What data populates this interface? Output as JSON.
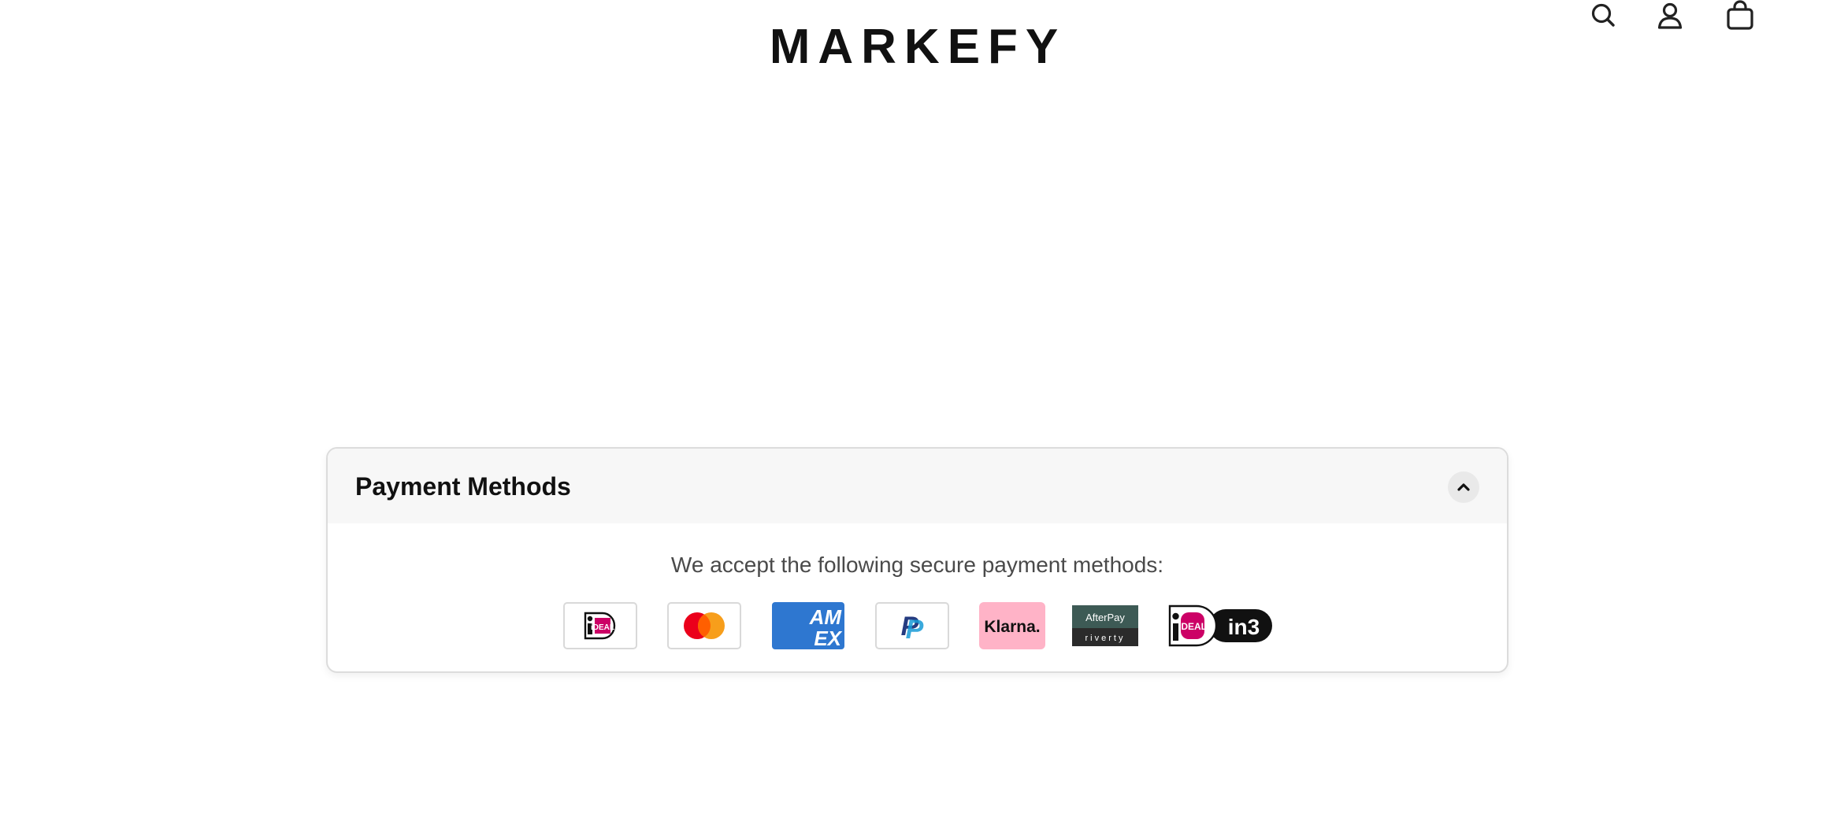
{
  "brand": {
    "logo_text": "MARKEFY"
  },
  "header": {
    "icons": [
      "search-icon",
      "account-icon",
      "cart-icon"
    ]
  },
  "accordion": {
    "title": "Payment Methods",
    "expanded": true,
    "toggle_icon": "chevron-up-icon",
    "description": "We accept the following secure payment methods:",
    "methods": [
      {
        "name": "iDEAL",
        "label": "iDEAL"
      },
      {
        "name": "Mastercard",
        "label": ""
      },
      {
        "name": "American Express",
        "label": "AM EX"
      },
      {
        "name": "PayPal",
        "label": "P"
      },
      {
        "name": "Klarna",
        "label": "Klarna."
      },
      {
        "name": "AfterPay Riverty",
        "label_top": "AfterPay",
        "label_bottom": "riverty"
      },
      {
        "name": "iDEAL in3",
        "label_left": "iDEAL",
        "label_right": "in3"
      }
    ]
  },
  "colors": {
    "ideal_pink": "#cc0066",
    "mastercard_red": "#eb001b",
    "mastercard_orange": "#f79e1b",
    "amex_blue": "#2e77d0",
    "paypal_dark": "#253b80",
    "paypal_light": "#179bd7",
    "klarna_pink": "#ffb3c7",
    "riverty_green": "#3d5a55"
  }
}
